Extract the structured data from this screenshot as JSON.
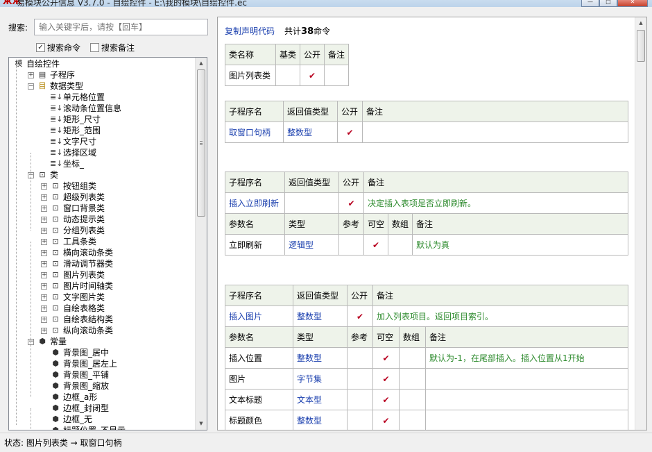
{
  "window": {
    "title": "易模块公开信息 V3.7.0 - 自绘控件 - E:\\我的模块\\自绘控件.ec",
    "minimize": "—",
    "maximize": "□",
    "close": "✕"
  },
  "search": {
    "label": "搜索:",
    "placeholder": "输入关键字后，请按【回车】"
  },
  "checks": [
    {
      "label": "搜索命令",
      "checked": true,
      "mark": "✓"
    },
    {
      "label": "搜索备注",
      "checked": false,
      "mark": ""
    }
  ],
  "tree": [
    {
      "label": "自绘控件",
      "icon": "模",
      "level": 0,
      "exp": ""
    },
    {
      "label": "子程序",
      "icon": "▤",
      "level": 1,
      "exp": "+"
    },
    {
      "label": "数据类型",
      "icon": "目",
      "level": 1,
      "exp": "−"
    },
    {
      "label": "单元格位置",
      "icon": "≣↓",
      "level": 2,
      "exp": ""
    },
    {
      "label": "滚动条位置信息",
      "icon": "≣↓",
      "level": 2,
      "exp": ""
    },
    {
      "label": "矩形_尺寸",
      "icon": "≣↓",
      "level": 2,
      "exp": ""
    },
    {
      "label": "矩形_范围",
      "icon": "≣↓",
      "level": 2,
      "exp": ""
    },
    {
      "label": "文字尺寸",
      "icon": "≣↓",
      "level": 2,
      "exp": ""
    },
    {
      "label": "选择区域",
      "icon": "≣↓",
      "level": 2,
      "exp": ""
    },
    {
      "label": "坐标_",
      "icon": "≣↓",
      "level": 2,
      "exp": ""
    },
    {
      "label": "类",
      "icon": "⊡",
      "level": 1,
      "exp": "−"
    },
    {
      "label": "按钮组类",
      "icon": "⊡",
      "level": 2,
      "exp": "+"
    },
    {
      "label": "超级列表类",
      "icon": "⊡",
      "level": 2,
      "exp": "+"
    },
    {
      "label": "窗口背景类",
      "icon": "⊡",
      "level": 2,
      "exp": "+"
    },
    {
      "label": "动态提示类",
      "icon": "⊡",
      "level": 2,
      "exp": "+"
    },
    {
      "label": "分组列表类",
      "icon": "⊡",
      "level": 2,
      "exp": "+"
    },
    {
      "label": "工具条类",
      "icon": "⊡",
      "level": 2,
      "exp": "+"
    },
    {
      "label": "横向滚动条类",
      "icon": "⊡",
      "level": 2,
      "exp": "+"
    },
    {
      "label": "滑动调节器类",
      "icon": "⊡",
      "level": 2,
      "exp": "+"
    },
    {
      "label": "图片列表类",
      "icon": "⊡",
      "level": 2,
      "exp": "+"
    },
    {
      "label": "图片时间轴类",
      "icon": "⊡",
      "level": 2,
      "exp": "+"
    },
    {
      "label": "文字图片类",
      "icon": "⊡",
      "level": 2,
      "exp": "+"
    },
    {
      "label": "自绘表格类",
      "icon": "⊡",
      "level": 2,
      "exp": "+"
    },
    {
      "label": "自绘表结构类",
      "icon": "⊡",
      "level": 2,
      "exp": "+"
    },
    {
      "label": "纵向滚动条类",
      "icon": "⊡",
      "level": 2,
      "exp": "+"
    },
    {
      "label": "常量",
      "icon": "⬢",
      "level": 1,
      "exp": "−"
    },
    {
      "label": "背景图_居中",
      "icon": "⬢",
      "level": 2,
      "exp": ""
    },
    {
      "label": "背景图_居左上",
      "icon": "⬢",
      "level": 2,
      "exp": ""
    },
    {
      "label": "背景图_平铺",
      "icon": "⬢",
      "level": 2,
      "exp": ""
    },
    {
      "label": "背景图_缩放",
      "icon": "⬢",
      "level": 2,
      "exp": ""
    },
    {
      "label": "边框_a形",
      "icon": "⬢",
      "level": 2,
      "exp": ""
    },
    {
      "label": "边框_封闭型",
      "icon": "⬢",
      "level": 2,
      "exp": ""
    },
    {
      "label": "边框_无",
      "icon": "⬢",
      "level": 2,
      "exp": ""
    },
    {
      "label": "标题位置_不显示",
      "icon": "⬢",
      "level": 2,
      "exp": ""
    }
  ],
  "doc": {
    "copy_link": "复制声明代码",
    "total_prefix": "共计",
    "total_count": "38",
    "total_suffix": "命令",
    "class_table": {
      "header": [
        "类名称",
        "基类",
        "公开",
        "备注"
      ],
      "row": [
        "图片列表类",
        "",
        "✔",
        ""
      ]
    },
    "sub1": {
      "header": [
        "子程序名",
        "返回值类型",
        "公开",
        "备注"
      ],
      "row": [
        "取窗口句柄",
        "整数型",
        "✔",
        ""
      ]
    },
    "sub2": {
      "header": [
        "子程序名",
        "返回值类型",
        "公开",
        "备注"
      ],
      "row": [
        "插入立即刷新",
        "",
        "✔",
        "决定插入表项是否立即刷新。"
      ],
      "param_header": [
        "参数名",
        "类型",
        "参考",
        "可空",
        "数组",
        "备注"
      ],
      "params": [
        [
          "立即刷新",
          "逻辑型",
          "",
          "✔",
          "",
          "默认为真"
        ]
      ]
    },
    "sub3": {
      "header": [
        "子程序名",
        "返回值类型",
        "公开",
        "备注"
      ],
      "row": [
        "插入图片",
        "整数型",
        "✔",
        "加入列表项目。返回项目索引。"
      ],
      "param_header": [
        "参数名",
        "类型",
        "参考",
        "可空",
        "数组",
        "备注"
      ],
      "params": [
        [
          "插入位置",
          "整数型",
          "",
          "✔",
          "",
          "默认为-1，在尾部插入。插入位置从1开始"
        ],
        [
          "图片",
          "字节集",
          "",
          "✔",
          "",
          ""
        ],
        [
          "文本标题",
          "文本型",
          "",
          "✔",
          "",
          ""
        ],
        [
          "标题颜色",
          "整数型",
          "",
          "✔",
          "",
          ""
        ]
      ]
    }
  },
  "status": {
    "text": "状态:  图片列表类 → 取窗口句柄"
  },
  "colors": {
    "header_bg": "#eef3ea",
    "link": "#1a3fae",
    "note": "#2e8b2e",
    "tick": "#b8001f"
  }
}
